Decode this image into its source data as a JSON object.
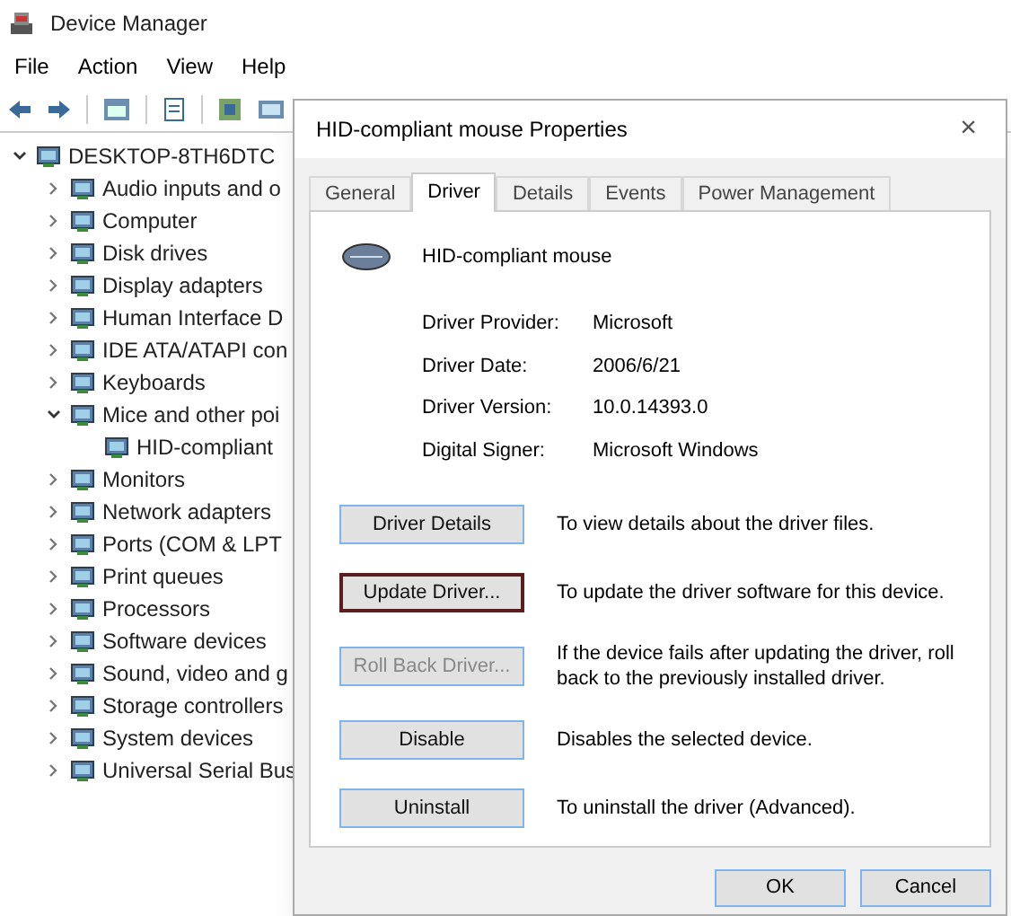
{
  "window": {
    "title": "Device Manager"
  },
  "menu": [
    "File",
    "Action",
    "View",
    "Help"
  ],
  "tree": {
    "label": "DESKTOP-8TH6DTC",
    "expanded": true,
    "children": [
      {
        "label": "Audio inputs and o",
        "expanded": false
      },
      {
        "label": "Computer",
        "expanded": false
      },
      {
        "label": "Disk drives",
        "expanded": false
      },
      {
        "label": "Display adapters",
        "expanded": false
      },
      {
        "label": "Human Interface D",
        "expanded": false
      },
      {
        "label": "IDE ATA/ATAPI con",
        "expanded": false
      },
      {
        "label": "Keyboards",
        "expanded": false
      },
      {
        "label": "Mice and other poi",
        "expanded": true,
        "children": [
          {
            "label": "HID-compliant"
          }
        ]
      },
      {
        "label": "Monitors",
        "expanded": false
      },
      {
        "label": "Network adapters",
        "expanded": false
      },
      {
        "label": "Ports (COM & LPT",
        "expanded": false
      },
      {
        "label": "Print queues",
        "expanded": false
      },
      {
        "label": "Processors",
        "expanded": false
      },
      {
        "label": "Software devices",
        "expanded": false
      },
      {
        "label": "Sound, video and g",
        "expanded": false
      },
      {
        "label": "Storage controllers",
        "expanded": false
      },
      {
        "label": "System devices",
        "expanded": false
      },
      {
        "label": "Universal Serial Bus",
        "expanded": false
      }
    ]
  },
  "dialog": {
    "title": "HID-compliant mouse Properties",
    "close": "×",
    "tabs": [
      {
        "label": "General",
        "selected": false
      },
      {
        "label": "Driver",
        "selected": true
      },
      {
        "label": "Details",
        "selected": false
      },
      {
        "label": "Events",
        "selected": false
      },
      {
        "label": "Power Management",
        "selected": false
      }
    ],
    "device_name": "HID-compliant mouse",
    "properties": [
      {
        "label": "Driver Provider:",
        "value": "Microsoft"
      },
      {
        "label": "Driver Date:",
        "value": "2006/6/21"
      },
      {
        "label": "Driver Version:",
        "value": "10.0.14393.0"
      },
      {
        "label": "Digital Signer:",
        "value": "Microsoft Windows"
      }
    ],
    "actions": [
      {
        "button": "Driver Details",
        "description": "To view details about the driver files.",
        "focused": false,
        "disabled": false
      },
      {
        "button": "Update Driver...",
        "description": "To update the driver software for this device.",
        "focused": true,
        "disabled": false
      },
      {
        "button": "Roll Back Driver...",
        "description": "If the device fails after updating the driver, roll back to the previously installed driver.",
        "focused": false,
        "disabled": true
      },
      {
        "button": "Disable",
        "description": "Disables the selected device.",
        "focused": false,
        "disabled": false
      },
      {
        "button": "Uninstall",
        "description": "To uninstall the driver (Advanced).",
        "focused": false,
        "disabled": false
      }
    ],
    "buttons": [
      "OK",
      "Cancel"
    ]
  }
}
